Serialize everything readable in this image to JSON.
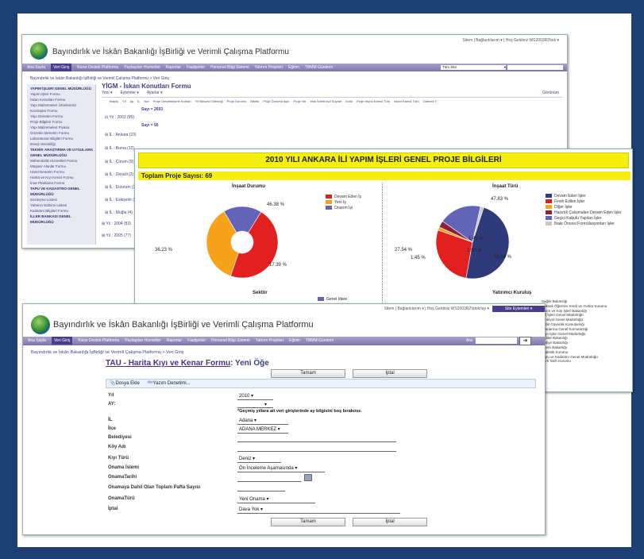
{
  "colors": {
    "frame": "#1d3f73",
    "nav": "#8a80b8",
    "accent": "#4a3e8c",
    "yellow": "#f5ef10",
    "red": "#e32020",
    "orange": "#f7a21b",
    "purple": "#6264b8",
    "navy": "#2e3a7a"
  },
  "shot1": {
    "topbar": "Sitem  |  Bağlantılarım ▾  |  Hoş Geldiniz WS2003R2\\tok ▾",
    "app_title": "Bayındırlık ve İskân Bakanlığı İşBirliği ve Verimli Çalışma Platformu",
    "nav": [
      "Ana Sayfa",
      "Veri Giriş",
      "Karar Destek Platformu",
      "Paylaşılan Hizmetler",
      "Raporlar",
      "Faaliyetler",
      "Personel Bilgi Sistemi",
      "Yatırım Projeleri",
      "Eğitim",
      "TBMM Gündem"
    ],
    "search_scope": "Tüm Site",
    "breadcrumb": "Bayındırlık ve İskân Bakanlığı İşBirliği ve Verimli Çalışma Platformu > Veri Giriş",
    "list_title": "YİGM - İskan Konutları Formu",
    "toolbar": [
      "Yeni ▾",
      "Eylemler ▾",
      "Ayarlar ▾"
    ],
    "view_label": "Görünüm",
    "columns": [
      "Başlık",
      "Yıl",
      "Ay",
      "İL",
      "İlce",
      "Proje Gerçekleşme Kodları",
      "Yıl Bütçesi Ödeneği",
      "Proje Durumu",
      "Nitelik",
      "Proje Durumu açık",
      "Proje Yer",
      "Hak Sahibi Adi Soyadi",
      "Kodlı",
      "Proje Hiçmi Kamul Türü",
      "İskan Kamul Türü",
      "Ödenek T"
    ],
    "rows": [
      "Sayı = 2693",
      "Sayı = 95",
      "⊟ Yıl : 2003 (95)",
      "⊞ İL : Ankara (23)",
      "⊞ İL : Bursa (12)",
      "⊞ İL : Çorum (9)",
      "⊞ İL : Denizli (2)",
      "⊞ İL : Erzurum (3)",
      "⊞ İL : Eskişehir (5)",
      "⊞ İL : Muğla (4)",
      "⊞ Yıl : 2004 (83)",
      "⊞ Yıl : 2005 (77)"
    ],
    "sidebar": [
      {
        "t": "YAPIM İŞLERİ GENEL MÜDÜRLÜĞÜ",
        "h": true
      },
      {
        "t": "Yapım İşleri Formu"
      },
      {
        "t": "İskan Konutları Formu"
      },
      {
        "t": "Yapı Malzemeleri Ürünlerimiz"
      },
      {
        "t": "Kuruluşlar Formu"
      },
      {
        "t": "Yapı Denetim Formu"
      },
      {
        "t": "Proje Bilgileri Formu"
      },
      {
        "t": "Yapı Malzemeleri Piyasa"
      },
      {
        "t": "Gözetim Denetim Formu"
      },
      {
        "t": "Laboratuvar Bilgileri Formu"
      },
      {
        "t": "Enerji Verimliliği"
      },
      {
        "t": "TEKNİK ARAŞTIRMA VE UYGULAMA GENEL MÜDÜRLÜĞÜ",
        "h": true
      },
      {
        "t": "Mühendislik Hizmetleri Formu"
      },
      {
        "t": "Müşavir Alanlar Formu"
      },
      {
        "t": "Harel Denetim Formu"
      },
      {
        "t": "Harita ve Kıyı Kenar Formu"
      },
      {
        "t": "İmar Planlama Formu"
      },
      {
        "t": "TAPU VE KADASTRO GENEL MÜDÜRLÜĞÜ",
        "h": true
      },
      {
        "t": "Sözleşme Listesi"
      },
      {
        "t": "Yabancı Edinimi Listesi"
      },
      {
        "t": "Kadastro Bilgileri Formu"
      },
      {
        "t": "İLLER BANKASI GENEL MÜDÜRLÜĞÜ",
        "h": true
      }
    ]
  },
  "shot2": {
    "header": "2010 YILI ANKARA İLİ YAPIM İŞLERİ GENEL PROJE BİLGİLERİ",
    "total": "Toplam Proje Sayısı: 69",
    "chart1_title": "İnşaat Durumu",
    "chart2_title": "İnşaat Türü",
    "sub1": "Sektör",
    "sub2": "Yatırımcı Kuruluş",
    "sub1_legend": "Genel İdare",
    "ministries": [
      "Sağlık Bakanlığı",
      "Yüksek Öğrenim Kredi ve Yurtlar Kurumu",
      "Tarım ve Köy İşleri Bakanlığı",
      "Yol İşleri Genel Müdürlüğü",
      "Emniyet Genel Müdürlüğü",
      "Sahil Güvenlik Komutanlığı",
      "Jandarma Genel Komutanlığı",
      "Yapı İşleri Genel Müdürlüğü",
      "Adalet Bakanlığı",
      "Maliye Bakanlığı",
      "Çevre Bakanlığı",
      "İstatistik Kurumu",
      "Tapu ve Kadastro Genel Müdürlüğü",
      "Türk Tarih Kurumu"
    ]
  },
  "chart_data": [
    {
      "type": "pie",
      "title": "İnşaat Durumu",
      "style": "donut",
      "categories": [
        "Devam Eden İş",
        "Yeni İş",
        "Onarım İşi"
      ],
      "values": [
        46.38,
        36.23,
        17.39
      ],
      "labels": [
        "46.38 %",
        "36.23 %",
        "17.39 %"
      ],
      "colors": [
        "#e32020",
        "#f7a21b",
        "#6264b8"
      ]
    },
    {
      "type": "pie",
      "title": "İnşaat Türü",
      "categories": [
        "Devam Eden İşler",
        "Fesih Edilen İşler",
        "Diğer İşler",
        "Hazırlık Çalışmaları Devam Eden İşler",
        "Geçici Kabulü Yapılan İşler",
        "İhale Öncesi Formülasyonları İşler"
      ],
      "values": [
        47.83,
        27.54,
        1.45,
        2.9,
        18.84,
        1.45
      ],
      "labels": [
        "47.83 %",
        "27.54 %",
        "1.45 %",
        "2.90 %",
        "18.84 %",
        "1.45 %"
      ],
      "colors": [
        "#2e3a7a",
        "#e32020",
        "#f7a21b",
        "#8c1f3a",
        "#6264b8",
        "#c8c8c8"
      ]
    }
  ],
  "shot3": {
    "topbar": "Sitem  |  Bağlantılarım ▾  |  Hoş Geldiniz WS2003R2\\tdoknay ▾",
    "site_actions": "Site Eylemleri ▾",
    "app_title": "Bayındırlık ve İskân Bakanlığı İşBirliği ve Verimli Çalışma Platformu",
    "nav": [
      "Ana Sayfa",
      "Veri Giriş",
      "Karar Destek Platformu",
      "Paylaşılan Hizmetler",
      "Raporlar",
      "Faaliyetler",
      "Personel Bilgi Sistemi",
      "Yatırım Projeleri",
      "Eğitim",
      "TBMM Gündem"
    ],
    "search_label": "Ara",
    "breadcrumb": "Bayındırlık ve İskân Bakanlığı İşBirliği ve Verimli Çalışma Platformu > Veri Giriş",
    "form_title_link": "TAU - Harita Kıyı ve Kenar Formu",
    "form_title_rest": ": Yeni Öğe",
    "ok": "Tamam",
    "cancel": "İptal",
    "attach": "Dosya Ekle",
    "spell": "Yazım Denetimi...",
    "fields": [
      {
        "label": "Yıl",
        "value": "2010 ▾"
      },
      {
        "label": "AY:",
        "value": "▾",
        "note": "*Geçmiş yıllara ait veri girişlerinde ay bilgisini boş bırakınız."
      },
      {
        "label": "İL",
        "value": "Adana ▾"
      },
      {
        "label": "İlce",
        "value": "ADANA MERKEZ ▾"
      },
      {
        "label": "Belediyesi",
        "value": ""
      },
      {
        "label": "Köy Adı",
        "value": ""
      },
      {
        "label": "Kıyı Türü",
        "value": "Deniz ▾"
      },
      {
        "label": "Onama İslemi",
        "value": "Ön İnceleme Aşamasında ▾"
      },
      {
        "label": "OnamaTarihi",
        "value": ""
      },
      {
        "label": "Onamaya Dahil Olan Toplam Pafta Sayısı",
        "value": ""
      },
      {
        "label": "OnamaTürü",
        "value": "Yeni Onama ▾"
      },
      {
        "label": "İptal",
        "value": "Dava Yok ▾"
      }
    ]
  }
}
